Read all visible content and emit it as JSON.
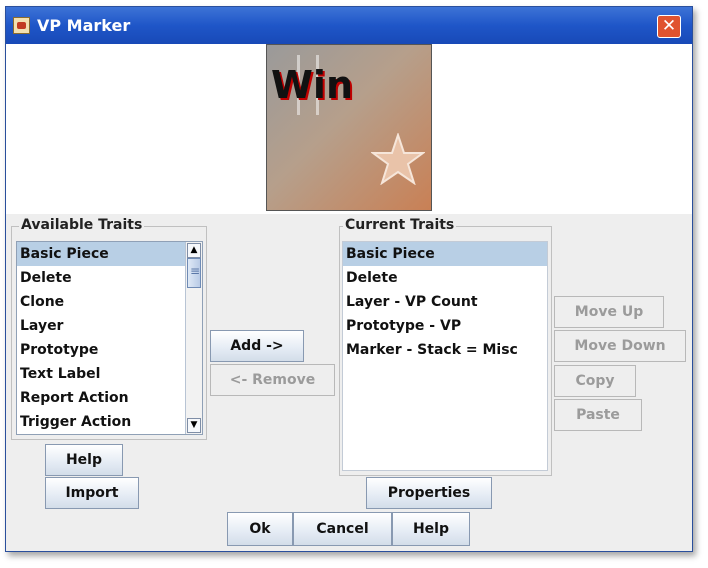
{
  "window": {
    "title": "VP Marker",
    "close_glyph": "✕"
  },
  "preview": {
    "piece_text": "Win"
  },
  "available": {
    "label": "Available Traits",
    "items": [
      "Basic Piece",
      "Delete",
      "Clone",
      "Layer",
      "Prototype",
      "Text Label",
      "Report Action",
      "Trigger Action"
    ],
    "selected_index": 0
  },
  "current": {
    "label": "Current Traits",
    "items": [
      "Basic Piece",
      "Delete",
      "Layer - VP Count",
      "Prototype - VP",
      "Marker - Stack = Misc"
    ],
    "selected_index": 0
  },
  "buttons": {
    "add": "Add ->",
    "remove": "<- Remove",
    "move_up": "Move Up",
    "move_down": "Move Down",
    "copy": "Copy",
    "paste": "Paste",
    "help_left": "Help",
    "import": "Import",
    "properties": "Properties",
    "ok": "Ok",
    "cancel": "Cancel",
    "help_bottom": "Help"
  },
  "scrollbar": {
    "up_glyph": "▲",
    "down_glyph": "▼"
  },
  "colors": {
    "selection": "#b8cfe5",
    "titlebar": "#1f56c8",
    "close": "#e0532f"
  }
}
